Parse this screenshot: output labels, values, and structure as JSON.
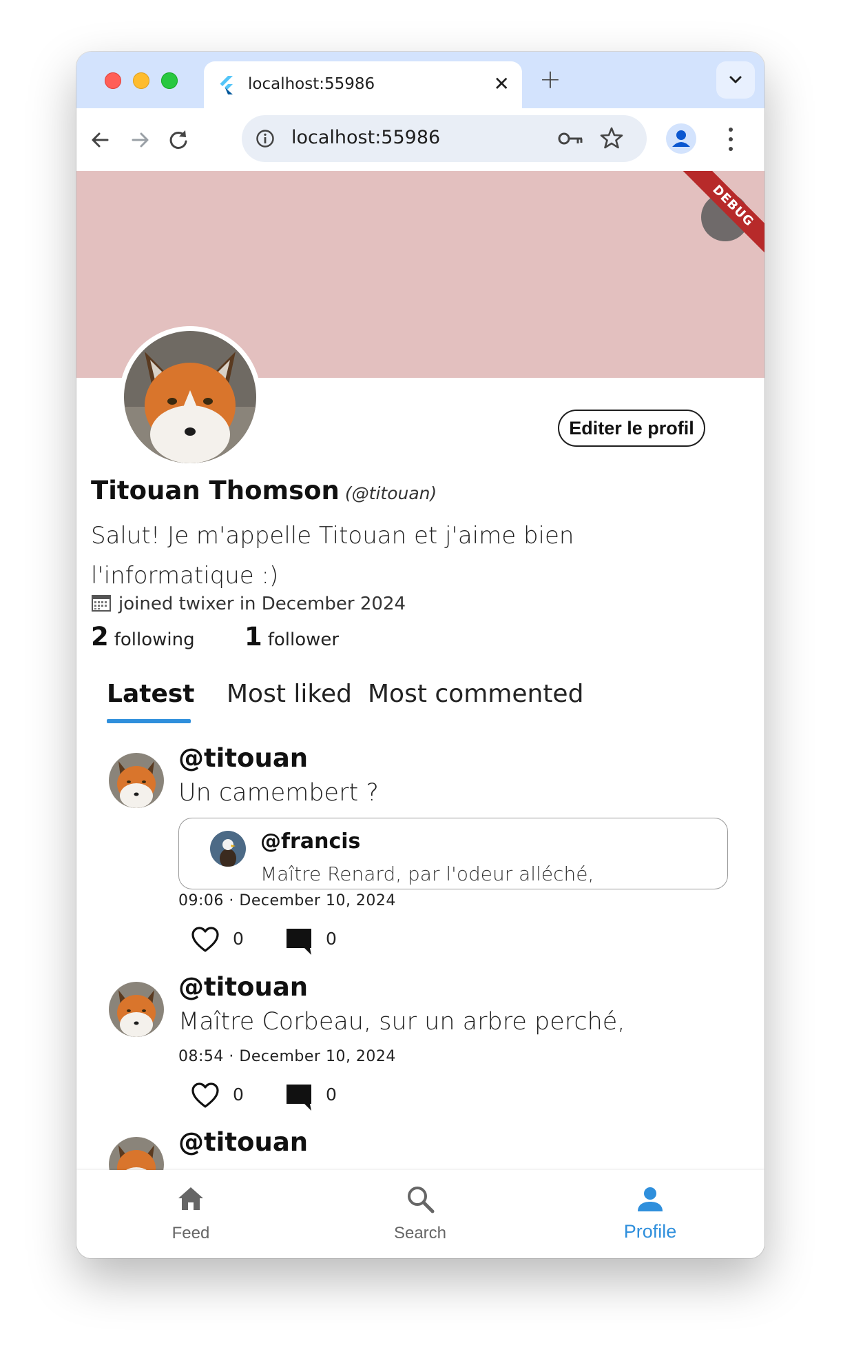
{
  "browser": {
    "tab_title": "localhost:55986",
    "url": "localhost:55986",
    "new_tab_symbol": "+",
    "close_symbol": "✕"
  },
  "debug": {
    "label": "DEBUG"
  },
  "profile": {
    "edit_button": "Editer le profil",
    "display_name": "Titouan Thomson",
    "handle": "(@titouan)",
    "bio": "Salut! Je m'appelle Titouan et j'aime bien l'informatique :)",
    "joined": "joined twixer in December 2024",
    "following_count": "2",
    "following_label": "following",
    "followers_count": "1",
    "followers_label": "follower",
    "banner_color": "#e3c0bf"
  },
  "tabs": {
    "latest": "Latest",
    "most_liked": "Most liked",
    "most_commented": "Most commented"
  },
  "posts": [
    {
      "handle": "@titouan",
      "text": "Un camembert ?",
      "quote": {
        "handle": "@francis",
        "text": "Maître Renard, par l'odeur alléché,"
      },
      "time": "09:06 · December 10, 2024",
      "likes": "0",
      "comments": "0"
    },
    {
      "handle": "@titouan",
      "text": " Maître Corbeau, sur un arbre perché,",
      "time": "08:54 · December 10, 2024",
      "likes": "0",
      "comments": "0"
    },
    {
      "handle": "@titouan"
    }
  ],
  "bottom_nav": {
    "feed": "Feed",
    "search": "Search",
    "profile": "Profile"
  },
  "colors": {
    "accent": "#2f8fdc",
    "debug": "#b72a2a"
  }
}
